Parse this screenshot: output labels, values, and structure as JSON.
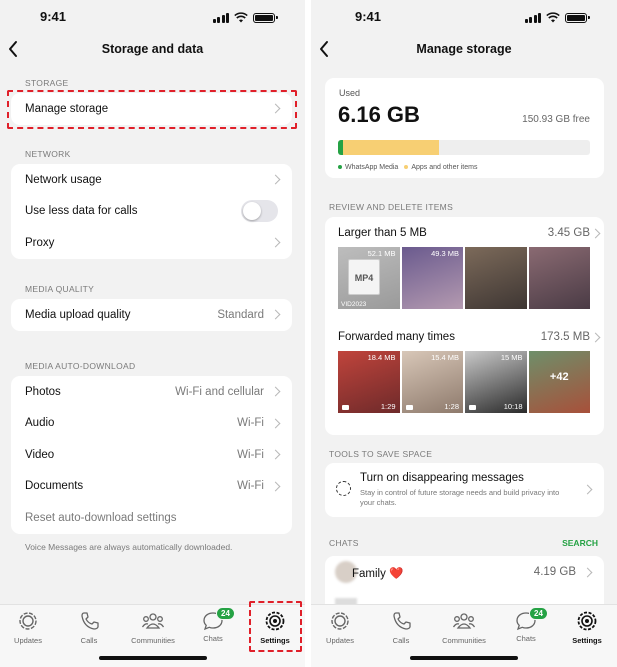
{
  "status": {
    "time": "9:41"
  },
  "left": {
    "nav": {
      "title": "Storage and data"
    },
    "sections": {
      "storage": "STORAGE",
      "network": "NETWORK",
      "media_quality": "MEDIA QUALITY",
      "auto_download": "MEDIA AUTO-DOWNLOAD"
    },
    "rows": {
      "manage_storage": "Manage storage",
      "network_usage": "Network usage",
      "use_less_data": "Use less data for calls",
      "proxy": "Proxy",
      "media_upload": "Media upload quality",
      "media_upload_value": "Standard",
      "photos": "Photos",
      "photos_value": "Wi-Fi and cellular",
      "audio": "Audio",
      "audio_value": "Wi-Fi",
      "video": "Video",
      "video_value": "Wi-Fi",
      "documents": "Documents",
      "documents_value": "Wi-Fi",
      "reset": "Reset auto-download settings"
    },
    "note": "Voice Messages are always automatically downloaded.",
    "use_less_data_on": false
  },
  "right": {
    "nav": {
      "title": "Manage storage"
    },
    "used_label": "Used",
    "used_value": "6.16 GB",
    "free": "150.93 GB free",
    "usage_fraction": {
      "whatsapp": 0.02,
      "other": 0.38
    },
    "legend": {
      "whatsapp": "WhatsApp Media",
      "other": "Apps and other items"
    },
    "review_header": "REVIEW AND DELETE ITEMS",
    "larger": {
      "title": "Larger than 5 MB",
      "size": "3.45 GB",
      "thumbs": [
        {
          "label": "52.1 MB",
          "doc": "MP4",
          "fname": "VID2023",
          "colors": [
            "#bdbdbd",
            "#9a9a9a"
          ]
        },
        {
          "label": "49.3 MB",
          "colors": [
            "#6a5a8e",
            "#b49ab0"
          ]
        },
        {
          "label": "",
          "colors": [
            "#7c6a5a",
            "#3e3633"
          ]
        },
        {
          "label": "",
          "colors": [
            "#8a6a72",
            "#4a3b45"
          ]
        }
      ]
    },
    "forwarded": {
      "title": "Forwarded many times",
      "size": "173.5 MB",
      "thumbs": [
        {
          "label": "18.4 MB",
          "duration": "1:29",
          "colors": [
            "#c0443c",
            "#6e2a2a"
          ]
        },
        {
          "label": "15.4 MB",
          "duration": "1:28",
          "colors": [
            "#d8c7b8",
            "#8e7a6c"
          ]
        },
        {
          "label": "15 MB",
          "duration": "10:18",
          "colors": [
            "#c9c9c9",
            "#2a2a2a"
          ]
        },
        {
          "label": "",
          "plus": "+42",
          "colors": [
            "#6e8f6a",
            "#a8503a"
          ]
        }
      ]
    },
    "tools_header": "TOOLS TO SAVE SPACE",
    "tool": {
      "title": "Turn on disappearing messages",
      "subtitle": "Stay in control of future storage needs and build privacy into your chats."
    },
    "chats_header": "CHATS",
    "search": "SEARCH",
    "chats": [
      {
        "name": "Family ❤️",
        "size": "4.19 GB"
      }
    ]
  },
  "tabs": [
    {
      "label": "Updates",
      "icon": "updates-icon"
    },
    {
      "label": "Calls",
      "icon": "phone-icon"
    },
    {
      "label": "Communities",
      "icon": "communities-icon"
    },
    {
      "label": "Chats",
      "icon": "chat-bubble-icon",
      "badge": "24"
    },
    {
      "label": "Settings",
      "icon": "gear-icon"
    }
  ],
  "colors": {
    "accent": "#25a244",
    "highlight": "#e0202a",
    "storage_other": "#f7cf73"
  }
}
